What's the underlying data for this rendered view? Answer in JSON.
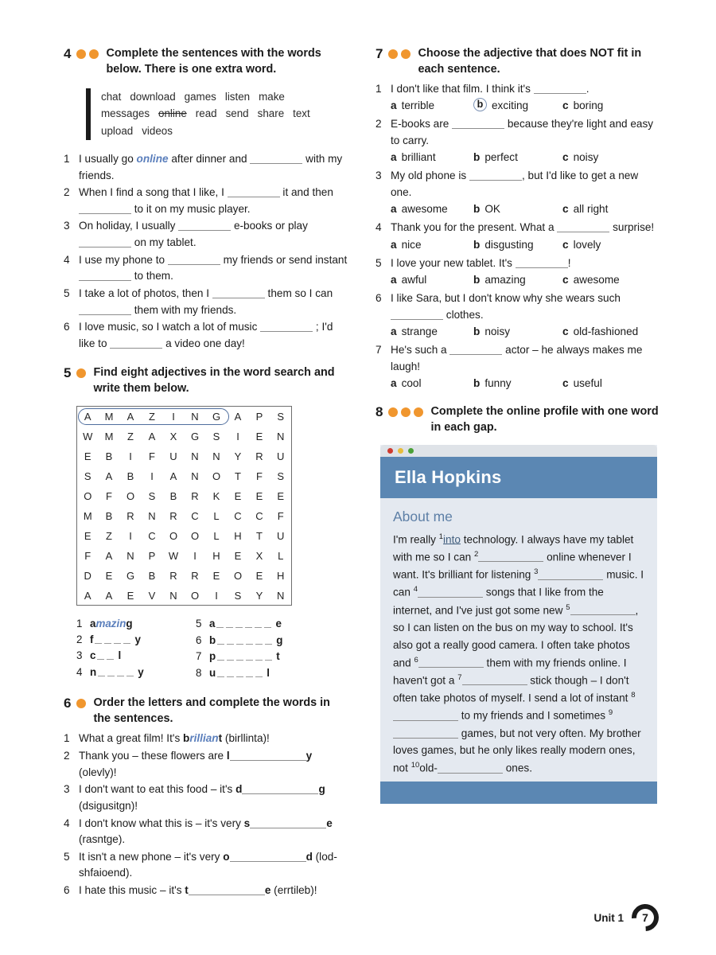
{
  "exercises": {
    "ex4": {
      "number": "4",
      "dots": 2,
      "title": "Complete the sentences with the words below. There is one extra word.",
      "wordbank": [
        {
          "word": "chat",
          "struck": false
        },
        {
          "word": "download",
          "struck": false
        },
        {
          "word": "games",
          "struck": false
        },
        {
          "word": "listen",
          "struck": false
        },
        {
          "word": "make",
          "struck": false
        },
        {
          "word": "messages",
          "struck": false
        },
        {
          "word": "online",
          "struck": true
        },
        {
          "word": "read",
          "struck": false
        },
        {
          "word": "send",
          "struck": false
        },
        {
          "word": "share",
          "struck": false
        },
        {
          "word": "text",
          "struck": false
        },
        {
          "word": "upload",
          "struck": false
        },
        {
          "word": "videos",
          "struck": false
        }
      ],
      "items": [
        "1|I usually go |online| after dinner and ____ with my friends.",
        "2|When I find a song that I like, I ____ it and then ____ to it on my music player.",
        "3|On holiday, I usually ____ e-books or play ____ on my tablet.",
        "4|I use my phone to ____ my friends or send instant ____ to them.",
        "5|I take a lot of photos, then I ____ them so I can ____ them with my friends.",
        "6|I love music, so I watch a lot of music ____ ; I'd like to ____ a video one day!"
      ]
    },
    "ex5": {
      "number": "5",
      "dots": 1,
      "title": "Find eight adjectives in the word search and write them below.",
      "grid": [
        [
          "A",
          "M",
          "A",
          "Z",
          "I",
          "N",
          "G",
          "A",
          "P",
          "S"
        ],
        [
          "W",
          "M",
          "Z",
          "A",
          "X",
          "G",
          "S",
          "I",
          "E",
          "N"
        ],
        [
          "E",
          "B",
          "I",
          "F",
          "U",
          "N",
          "N",
          "Y",
          "R",
          "U"
        ],
        [
          "S",
          "A",
          "B",
          "I",
          "A",
          "N",
          "O",
          "T",
          "F",
          "S"
        ],
        [
          "O",
          "F",
          "O",
          "S",
          "B",
          "R",
          "K",
          "E",
          "E",
          "E"
        ],
        [
          "M",
          "B",
          "R",
          "N",
          "R",
          "C",
          "L",
          "C",
          "C",
          "F"
        ],
        [
          "E",
          "Z",
          "I",
          "C",
          "O",
          "O",
          "L",
          "H",
          "T",
          "U"
        ],
        [
          "F",
          "A",
          "N",
          "P",
          "W",
          "I",
          "H",
          "E",
          "X",
          "L"
        ],
        [
          "D",
          "E",
          "G",
          "B",
          "R",
          "R",
          "E",
          "O",
          "E",
          "H"
        ],
        [
          "A",
          "A",
          "E",
          "V",
          "N",
          "O",
          "I",
          "S",
          "Y",
          "N"
        ]
      ],
      "circled_word": "AMAZING",
      "answers_left": [
        {
          "n": "1",
          "start": "a",
          "answer": "mazin",
          "end": "g",
          "dashes": 0,
          "solved": true
        },
        {
          "n": "2",
          "start": "f",
          "answer": "",
          "end": "y",
          "dashes": 4,
          "solved": false
        },
        {
          "n": "3",
          "start": "c",
          "answer": "",
          "end": "l",
          "dashes": 2,
          "solved": false
        },
        {
          "n": "4",
          "start": "n",
          "answer": "",
          "end": "y",
          "dashes": 4,
          "solved": false
        }
      ],
      "answers_right": [
        {
          "n": "5",
          "start": "a",
          "answer": "",
          "end": "e",
          "dashes": 6,
          "solved": false
        },
        {
          "n": "6",
          "start": "b",
          "answer": "",
          "end": "g",
          "dashes": 6,
          "solved": false
        },
        {
          "n": "7",
          "start": "p",
          "answer": "",
          "end": "t",
          "dashes": 6,
          "solved": false
        },
        {
          "n": "8",
          "start": "u",
          "answer": "",
          "end": "l",
          "dashes": 5,
          "solved": false
        }
      ]
    },
    "ex6": {
      "number": "6",
      "dots": 1,
      "title": "Order the letters and complete the words in the sentences.",
      "items": [
        {
          "n": "1",
          "pre": "What a great film! It's ",
          "bold_start": "b",
          "answer": "rillian",
          "bold_end": "t",
          "post": " (birllinta)!",
          "solved": true
        },
        {
          "n": "2",
          "pre": "Thank you – these flowers are ",
          "bold_start": "l",
          "answer": "",
          "bold_end": "y",
          "post": " (olevly)!",
          "solved": false
        },
        {
          "n": "3",
          "pre": "I don't want to eat this food – it's ",
          "bold_start": "d",
          "answer": "",
          "bold_end": "g",
          "post": " (dsigusitgn)!",
          "solved": false
        },
        {
          "n": "4",
          "pre": "I don't know what this is – it's very ",
          "bold_start": "s",
          "answer": "",
          "bold_end": "e",
          "post": " (rasntge).",
          "solved": false
        },
        {
          "n": "5",
          "pre": "It isn't a new phone – it's very ",
          "bold_start": "o",
          "answer": "",
          "bold_end": "d",
          "post": " (lod-shfaioend).",
          "solved": false
        },
        {
          "n": "6",
          "pre": "I hate this music – it's ",
          "bold_start": "t",
          "answer": "",
          "bold_end": "e",
          "post": " (errtileb)!",
          "solved": false
        }
      ]
    },
    "ex7": {
      "number": "7",
      "dots": 2,
      "title": "Choose the adjective that does NOT fit in each sentence.",
      "items": [
        {
          "n": "1",
          "sentence_parts": [
            "I don't like that film. I think it's ",
            "."
          ],
          "options": [
            {
              "letter": "a",
              "text": "terrible",
              "circled": false
            },
            {
              "letter": "b",
              "text": "exciting",
              "circled": true
            },
            {
              "letter": "c",
              "text": "boring",
              "circled": false
            }
          ]
        },
        {
          "n": "2",
          "sentence_parts": [
            "E-books are ",
            " because they're light and easy to carry."
          ],
          "options": [
            {
              "letter": "a",
              "text": "brilliant",
              "circled": false
            },
            {
              "letter": "b",
              "text": "perfect",
              "circled": false
            },
            {
              "letter": "c",
              "text": "noisy",
              "circled": false
            }
          ]
        },
        {
          "n": "3",
          "sentence_parts": [
            "My old phone is ",
            ", but I'd like to get a new one."
          ],
          "options": [
            {
              "letter": "a",
              "text": "awesome",
              "circled": false
            },
            {
              "letter": "b",
              "text": "OK",
              "circled": false
            },
            {
              "letter": "c",
              "text": "all right",
              "circled": false
            }
          ]
        },
        {
          "n": "4",
          "sentence_parts": [
            "Thank you for the present. What a ",
            " surprise!"
          ],
          "options": [
            {
              "letter": "a",
              "text": "nice",
              "circled": false
            },
            {
              "letter": "b",
              "text": "disgusting",
              "circled": false
            },
            {
              "letter": "c",
              "text": "lovely",
              "circled": false
            }
          ]
        },
        {
          "n": "5",
          "sentence_parts": [
            "I love your new tablet. It's ",
            "!"
          ],
          "options": [
            {
              "letter": "a",
              "text": "awful",
              "circled": false
            },
            {
              "letter": "b",
              "text": "amazing",
              "circled": false
            },
            {
              "letter": "c",
              "text": "awesome",
              "circled": false
            }
          ]
        },
        {
          "n": "6",
          "sentence_parts": [
            "I like Sara, but I don't know why she wears such ",
            " clothes."
          ],
          "options": [
            {
              "letter": "a",
              "text": "strange",
              "circled": false
            },
            {
              "letter": "b",
              "text": "noisy",
              "circled": false
            },
            {
              "letter": "c",
              "text": "old-fashioned",
              "circled": false
            }
          ]
        },
        {
          "n": "7",
          "sentence_parts": [
            "He's such a ",
            " actor – he always makes me laugh!"
          ],
          "options": [
            {
              "letter": "a",
              "text": "cool",
              "circled": false
            },
            {
              "letter": "b",
              "text": "funny",
              "circled": false
            },
            {
              "letter": "c",
              "text": "useful",
              "circled": false
            }
          ]
        }
      ]
    },
    "ex8": {
      "number": "8",
      "dots": 3,
      "title": "Complete the online profile with one word in each gap.",
      "card": {
        "profile_name": "Ella Hopkins",
        "section_heading": "About me",
        "text_segments": [
          {
            "t": "I'm really ",
            "type": "text"
          },
          {
            "t": "1",
            "type": "sup"
          },
          {
            "t": "into",
            "type": "answer"
          },
          {
            "t": " technology. I always have my tablet with me so I can ",
            "type": "text"
          },
          {
            "t": "2",
            "type": "sup"
          },
          {
            "t": "",
            "type": "gap-l"
          },
          {
            "t": " online whenever I want. It's brilliant for listening ",
            "type": "text"
          },
          {
            "t": "3",
            "type": "sup"
          },
          {
            "t": "",
            "type": "gap-l"
          },
          {
            "t": " music. I can ",
            "type": "text"
          },
          {
            "t": "4",
            "type": "sup"
          },
          {
            "t": "",
            "type": "gap-l"
          },
          {
            "t": " songs that I like from the internet, and I've just got some new ",
            "type": "text"
          },
          {
            "t": "5",
            "type": "sup"
          },
          {
            "t": "",
            "type": "gap-l"
          },
          {
            "t": ", so I can listen on the bus on my way to school. It's also got a really good camera. I often take photos and ",
            "type": "text"
          },
          {
            "t": "6",
            "type": "sup"
          },
          {
            "t": "",
            "type": "gap-l"
          },
          {
            "t": " them with my friends online. I haven't got a ",
            "type": "text"
          },
          {
            "t": "7",
            "type": "sup"
          },
          {
            "t": "",
            "type": "gap-l"
          },
          {
            "t": " stick though – I don't often take photos of myself. I send a lot of instant ",
            "type": "text"
          },
          {
            "t": "8",
            "type": "sup"
          },
          {
            "t": "",
            "type": "gap-l"
          },
          {
            "t": " to my friends and I sometimes ",
            "type": "text"
          },
          {
            "t": "9",
            "type": "sup"
          },
          {
            "t": "",
            "type": "gap-l"
          },
          {
            "t": " games, but not very often. My brother loves games, but he only likes really modern ones, not ",
            "type": "text"
          },
          {
            "t": "10",
            "type": "sup"
          },
          {
            "t": "old-",
            "type": "text"
          },
          {
            "t": "",
            "type": "gap-l"
          },
          {
            "t": " ones.",
            "type": "text"
          }
        ]
      }
    }
  },
  "footer": {
    "unit_label": "Unit 1",
    "page_number": "7"
  },
  "colors": {
    "dot_orange": "#f0962e",
    "card_blue": "#5b87b3",
    "answer_blue": "#5b7fbc",
    "heading_blue": "#5d7fa6"
  }
}
